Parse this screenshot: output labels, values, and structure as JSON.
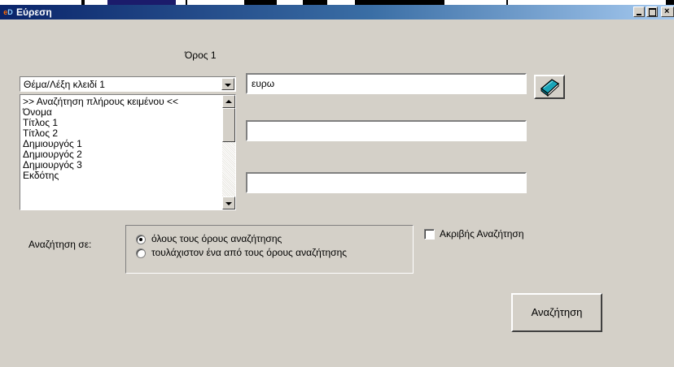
{
  "window": {
    "title": "Εύρεση"
  },
  "search": {
    "term_header": "Όρος 1",
    "field_combo_value": "Θέμα/Λέξη κλειδί 1",
    "field_options": [
      ">> Αναζήτηση πλήρους κειμένου <<",
      "Όνομα",
      "Τίτλος 1",
      "Τίτλος 2",
      "Δημιουργός 1",
      "Δημιουργός 2",
      "Δημιουργός 3",
      "Εκδότης"
    ],
    "term1_value": "ευρω",
    "term2_value": "",
    "term3_value": "",
    "search_in_label": "Αναζήτηση σε:",
    "radio_all_label": "όλους τους όρους αναζήτησης",
    "radio_any_label": "τουλάχιστον ένα από τους όρους αναζήτησης",
    "radio_selected": "all",
    "exact_label": "Ακριβής Αναζήτηση",
    "exact_checked": false,
    "submit_label": "Αναζήτηση"
  },
  "icons": {
    "app": "app-icon",
    "book": "book-icon",
    "minimize": "minimize-icon",
    "maximize": "maximize-icon",
    "close": "close-icon"
  },
  "colors": {
    "titlebar_start": "#0a246a",
    "titlebar_end": "#a6caf0",
    "dialog_bg": "#d4d0c8",
    "book_icon": "#19a4b8"
  }
}
